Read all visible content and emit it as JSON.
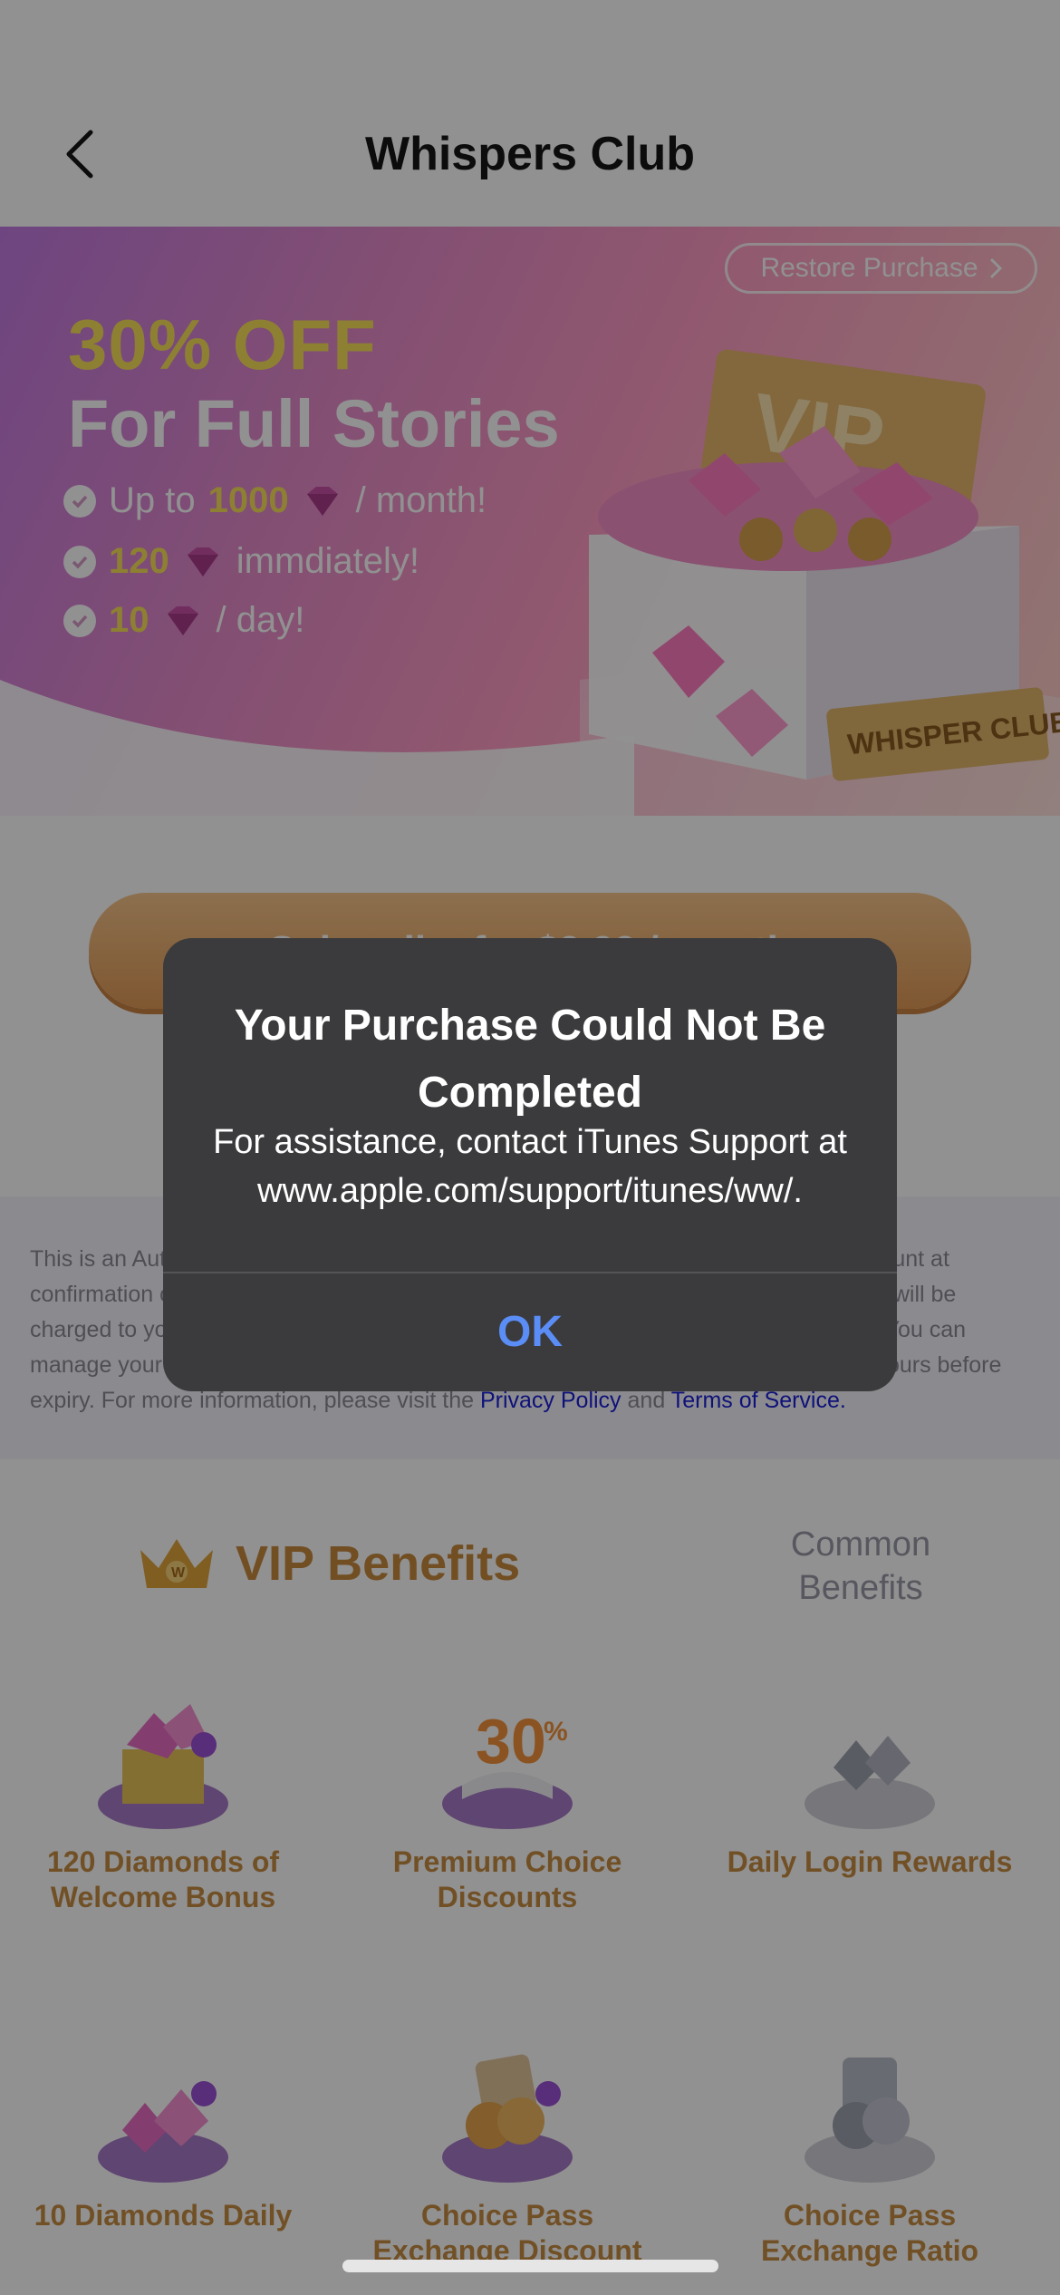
{
  "header": {
    "title": "Whispers Club"
  },
  "banner": {
    "restore_label": "Restore Purchase",
    "headline": "30% OFF",
    "subheadline": "For Full Stories",
    "line1": {
      "prefix": "Up to",
      "amount": "1000",
      "suffix": "/ month!"
    },
    "line2": {
      "amount": "120",
      "suffix": "immdiately!"
    },
    "line3": {
      "amount": "10",
      "suffix": "/ day!"
    },
    "box_text": "WHISPER CLUB",
    "card_text": "VIP"
  },
  "subscribe": {
    "label": "Subscribe for $9.99 / month"
  },
  "terms": {
    "text": "This is an Auto-Renewable Subscription. Payment will be charged to your iTunes account at confirmation of purchase. The subscription automatically renews unless canceled and will be charged to your iTunes account within 24 hours prior to the end of the current period. You can manage your subscriptions in Account Settings and turn off auto-renewal at least 24 hours before expiry. For more information, please visit the",
    "privacy_link": "Privacy Policy",
    "and": "and",
    "terms_link": "Terms of Service."
  },
  "benefits": {
    "vip_title": "VIP Benefits",
    "common_title": "Common Benefits",
    "items": [
      {
        "label": "120 Diamonds of Welcome Bonus",
        "icon": "gift-diamonds-icon"
      },
      {
        "label": "Premium Choice Discounts",
        "icon": "discount-30-icon"
      },
      {
        "label": "Daily Login Rewards",
        "icon": "gray-diamonds-icon"
      },
      {
        "label": "10 Diamonds Daily",
        "icon": "diamonds-daily-icon"
      },
      {
        "label": "Choice Pass Exchange Discount",
        "icon": "coins-icon"
      },
      {
        "label": "Choice Pass Exchange Ratio",
        "icon": "gray-coins-icon"
      }
    ]
  },
  "alert": {
    "title": "Your Purchase Could Not Be Completed",
    "message": "For assistance, contact iTunes Support at www.apple.com/support/itunes/ww/.",
    "ok_label": "OK"
  },
  "colors": {
    "accent_gold": "#c88a3e",
    "alert_bg": "#3b3b3d",
    "ok_blue": "#5b8df6",
    "promo_yellow": "#f8e25a",
    "link_blue": "#1b1fd6"
  }
}
